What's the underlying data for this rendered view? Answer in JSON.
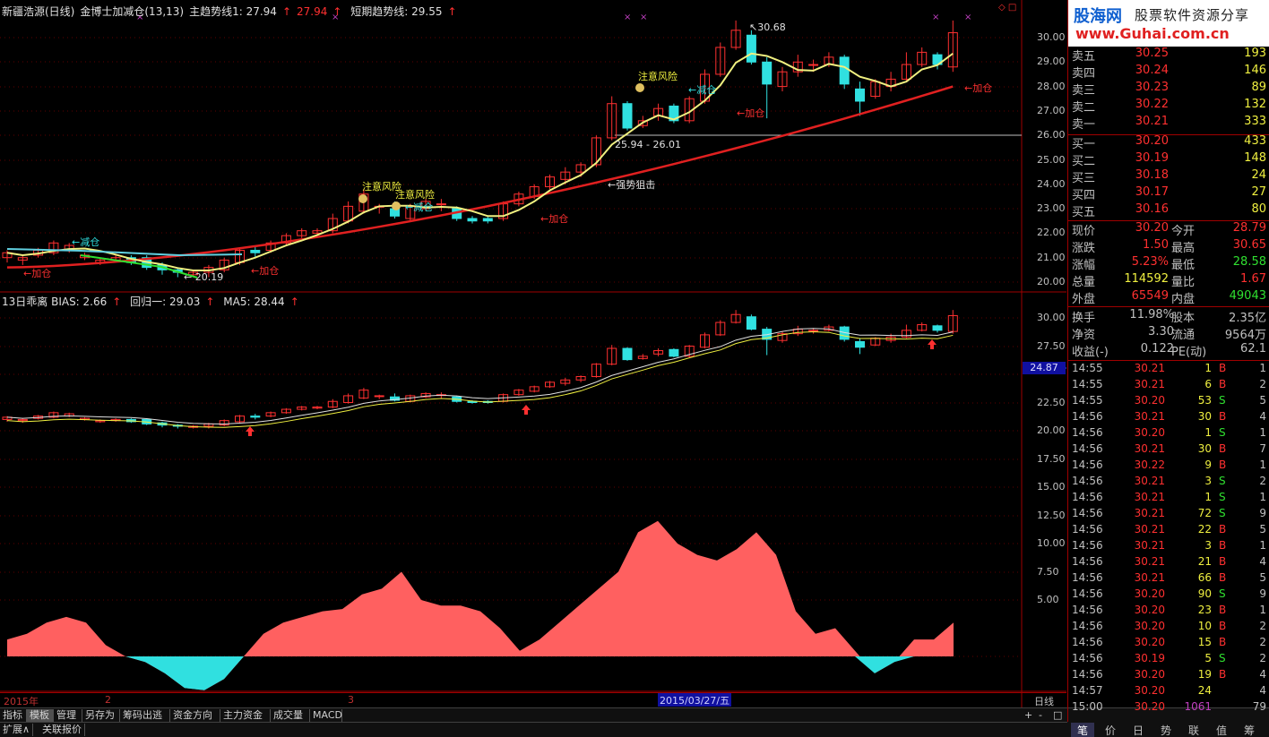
{
  "main_header": {
    "title": "新疆浩源(日线)",
    "indicator": "金博士加减仓(13,13)",
    "main_trend": "主趋势线1: 27.94",
    "main_trend2": "27.94",
    "short_trend": "短期趋势线: 29.55"
  },
  "sub_header": {
    "bias": "13日乖离  BIAS: 2.66",
    "revert": "回归一: 29.03",
    "ma5": "MA5: 28.44"
  },
  "price_axis": [
    "30.00",
    "29.00",
    "28.00",
    "27.00",
    "26.00",
    "25.00",
    "24.00",
    "23.00",
    "22.00",
    "21.00",
    "20.00"
  ],
  "sub_axis": [
    "30.00",
    "27.50",
    "22.50",
    "20.00",
    "17.50",
    "15.00",
    "12.50",
    "10.00",
    "7.50",
    "5.00"
  ],
  "price_tag": "24.87",
  "annotations": {
    "high": "30.68",
    "low": "20.19",
    "range": "25.94 - 26.01",
    "risk": "注意风险",
    "reduce": "←减仓",
    "add": "←加仓",
    "strong": "←强势狙击"
  },
  "date_bar": {
    "year": "2015年",
    "m2": "2",
    "m3": "3",
    "selected": "2015/03/27/五",
    "period": "日线"
  },
  "tabs": [
    "指标",
    "模板",
    "管理",
    "另存为",
    "筹码出逃",
    "资金方向",
    "主力资金",
    "成交量",
    "MACD"
  ],
  "active_tab": "模板",
  "tab_controls": [
    "+",
    "-",
    "□"
  ],
  "ext_tabs": [
    "扩展∧",
    "关联报价"
  ],
  "logo": {
    "brand": "股海网",
    "slogan": "股票软件资源分享",
    "url": "www.Guhai.com.cn"
  },
  "orderbook": {
    "asks": [
      {
        "label": "卖五",
        "price": "30.25",
        "vol": "193"
      },
      {
        "label": "卖四",
        "price": "30.24",
        "vol": "146"
      },
      {
        "label": "卖三",
        "price": "30.23",
        "vol": "89"
      },
      {
        "label": "卖二",
        "price": "30.22",
        "vol": "132"
      },
      {
        "label": "卖一",
        "price": "30.21",
        "vol": "333"
      }
    ],
    "bids": [
      {
        "label": "买一",
        "price": "30.20",
        "vol": "433"
      },
      {
        "label": "买二",
        "price": "30.19",
        "vol": "148"
      },
      {
        "label": "买三",
        "price": "30.18",
        "vol": "24"
      },
      {
        "label": "买四",
        "price": "30.17",
        "vol": "27"
      },
      {
        "label": "买五",
        "price": "30.16",
        "vol": "80"
      }
    ]
  },
  "stats": [
    {
      "l": "现价",
      "v": "30.20",
      "c": "#ff3030",
      "l2": "今开",
      "v2": "28.79",
      "c2": "#ff3030"
    },
    {
      "l": "涨跌",
      "v": "1.50",
      "c": "#ff3030",
      "l2": "最高",
      "v2": "30.65",
      "c2": "#ff3030"
    },
    {
      "l": "涨幅",
      "v": "5.23%",
      "c": "#ff3030",
      "l2": "最低",
      "v2": "28.58",
      "c2": "#30e030"
    },
    {
      "l": "总量",
      "v": "114592",
      "c": "#f0f040",
      "l2": "量比",
      "v2": "1.67",
      "c2": "#ff3030"
    },
    {
      "l": "外盘",
      "v": "65549",
      "c": "#ff3030",
      "l2": "内盘",
      "v2": "49043",
      "c2": "#30e030"
    }
  ],
  "stats2": [
    {
      "l": "换手",
      "v": "11.98%",
      "l2": "股本",
      "v2": "2.35亿"
    },
    {
      "l": "净资",
      "v": "3.30",
      "l2": "流通",
      "v2": "9564万"
    },
    {
      "l": "收益(-)",
      "v": "0.122",
      "l2": "PE(动)",
      "v2": "62.1"
    }
  ],
  "ticks": [
    {
      "t": "14:55",
      "p": "30.21",
      "v": "1",
      "s": "B",
      "n": "1"
    },
    {
      "t": "14:55",
      "p": "30.21",
      "v": "6",
      "s": "B",
      "n": "2"
    },
    {
      "t": "14:55",
      "p": "30.20",
      "v": "53",
      "s": "S",
      "n": "5"
    },
    {
      "t": "14:56",
      "p": "30.21",
      "v": "30",
      "s": "B",
      "n": "4"
    },
    {
      "t": "14:56",
      "p": "30.20",
      "v": "1",
      "s": "S",
      "n": "1"
    },
    {
      "t": "14:56",
      "p": "30.21",
      "v": "30",
      "s": "B",
      "n": "7"
    },
    {
      "t": "14:56",
      "p": "30.22",
      "v": "9",
      "s": "B",
      "n": "1"
    },
    {
      "t": "14:56",
      "p": "30.21",
      "v": "3",
      "s": "S",
      "n": "2"
    },
    {
      "t": "14:56",
      "p": "30.21",
      "v": "1",
      "s": "S",
      "n": "1"
    },
    {
      "t": "14:56",
      "p": "30.21",
      "v": "72",
      "s": "S",
      "n": "9"
    },
    {
      "t": "14:56",
      "p": "30.21",
      "v": "22",
      "s": "B",
      "n": "5"
    },
    {
      "t": "14:56",
      "p": "30.21",
      "v": "3",
      "s": "B",
      "n": "1"
    },
    {
      "t": "14:56",
      "p": "30.21",
      "v": "21",
      "s": "B",
      "n": "4"
    },
    {
      "t": "14:56",
      "p": "30.21",
      "v": "66",
      "s": "B",
      "n": "5"
    },
    {
      "t": "14:56",
      "p": "30.20",
      "v": "90",
      "s": "S",
      "n": "9"
    },
    {
      "t": "14:56",
      "p": "30.20",
      "v": "23",
      "s": "B",
      "n": "1"
    },
    {
      "t": "14:56",
      "p": "30.20",
      "v": "10",
      "s": "B",
      "n": "2"
    },
    {
      "t": "14:56",
      "p": "30.20",
      "v": "15",
      "s": "B",
      "n": "2"
    },
    {
      "t": "14:56",
      "p": "30.19",
      "v": "5",
      "s": "S",
      "n": "2"
    },
    {
      "t": "14:56",
      "p": "30.20",
      "v": "19",
      "s": "B",
      "n": "4"
    },
    {
      "t": "14:57",
      "p": "30.20",
      "v": "24",
      "s": "",
      "n": "4"
    },
    {
      "t": "15:00",
      "p": "30.20",
      "v": "1061",
      "s": "",
      "n": "79"
    }
  ],
  "bottom_tabs": [
    "笔",
    "价",
    "日",
    "势",
    "联",
    "值",
    "筹"
  ],
  "colors": {
    "up": "#ff3030",
    "down": "#30e0e0",
    "axis": "#a00000",
    "panel_bg": "#000000"
  }
}
